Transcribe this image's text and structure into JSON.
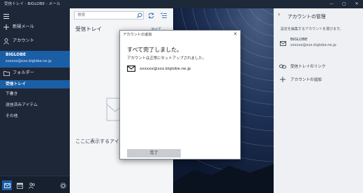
{
  "window": {
    "title": "受信トレイ - BIGLOBE - メール",
    "controls": [
      "minimize",
      "maximize",
      "close"
    ]
  },
  "sidebar": {
    "new_mail": "新規メール",
    "accounts_label": "アカウント",
    "account": {
      "name": "BIGLOBE",
      "email": "xxxxxx@xxx.biglobe.ne.jp"
    },
    "folders_label": "フォルダー",
    "folders": [
      {
        "label": "受信トレイ",
        "selected": true
      },
      {
        "label": "下書き",
        "selected": false
      },
      {
        "label": "送信済みアイテム",
        "selected": false
      },
      {
        "label": "その他",
        "selected": false
      }
    ],
    "bottom_icons": [
      "mail-icon",
      "calendar-icon",
      "people-icon",
      "settings-icon"
    ]
  },
  "list": {
    "search_placeholder": "検索",
    "title": "受信トレイ",
    "filter": "すべて ⌄",
    "empty_message": "ここに表示するアイテ"
  },
  "dialog": {
    "title": "アカウントの追加",
    "heading": "すべて完了しました。",
    "subtext": "アカウントは正常にセットアップされました。",
    "email": "xxxxxx@xxx.biglobe.ne.jp",
    "done_label": "完了"
  },
  "settings": {
    "title": "アカウントの管理",
    "description": "設定を編集するアカウントを選びます。",
    "account_name": "BIGLOBE",
    "account_email": "xxxxxx@xxx.biglobe.ne.jp",
    "link_inboxes": "受信トレイのリンク",
    "add_account": "アカウントの追加"
  },
  "colors": {
    "accent": "#1a5ea6",
    "sidebar_bg": "#1e2737",
    "pane_bg": "#f4f5f7",
    "settings_bg": "#eef0f3"
  }
}
